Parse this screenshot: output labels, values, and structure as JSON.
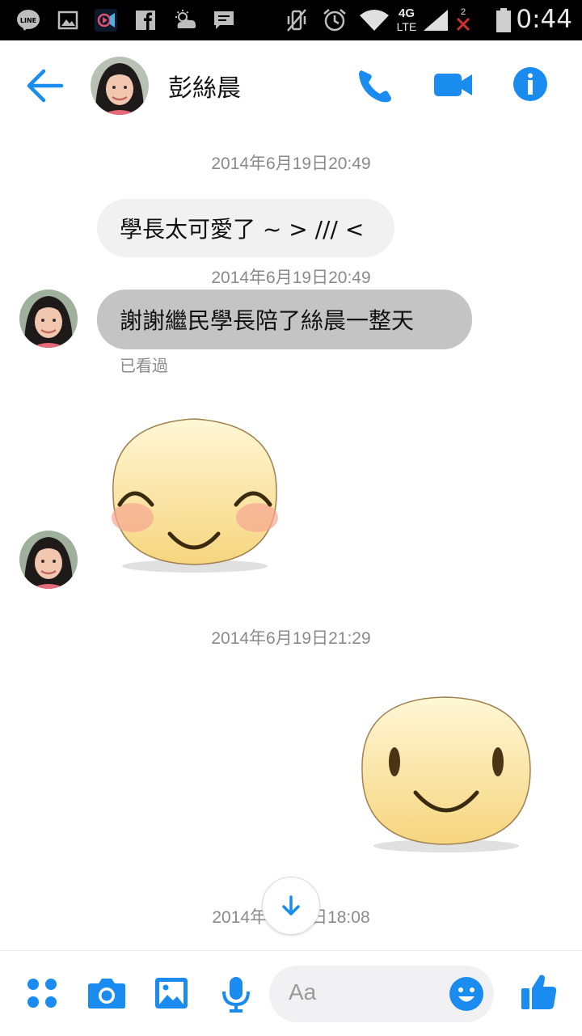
{
  "status_bar": {
    "time": "0:44",
    "network": "4G",
    "network_sub": "LTE",
    "sim_badge": "2",
    "line_label": "LINE"
  },
  "header": {
    "contact_name": "彭絲晨"
  },
  "messages": [
    {
      "timestamp": "2014年6月19日20:49",
      "text": "學長太可愛了 ~ > /// <"
    },
    {
      "timestamp": "2014年6月19日20:49",
      "text": "謝謝繼民學長陪了絲晨一整天"
    },
    {
      "timestamp": "2014年6月19日21:29"
    },
    {
      "timestamp_prefix": "2014年",
      "timestamp_suffix": "日18:08"
    }
  ],
  "seen_label": "已看過",
  "composer": {
    "placeholder": "Aa"
  },
  "colors": {
    "accent": "#1a8cf0",
    "bubble_gray": "#c4c4c4",
    "bubble_light": "#f1f1f1"
  }
}
